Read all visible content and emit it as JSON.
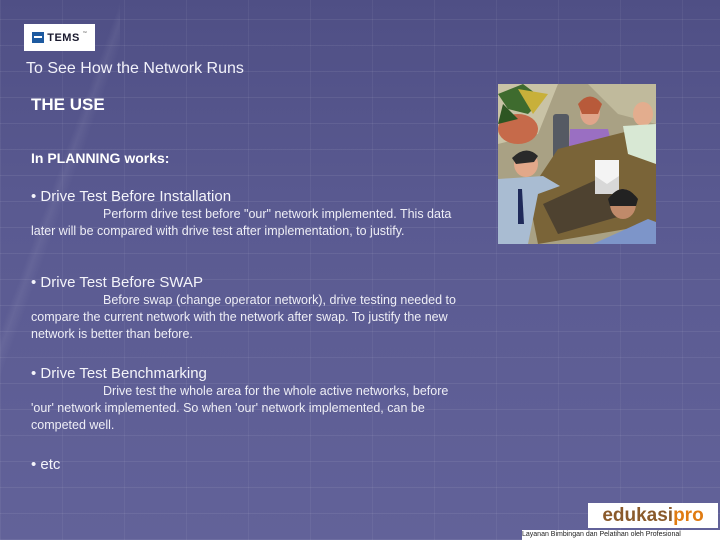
{
  "logo": {
    "brand": "TEMS",
    "trademark": "™"
  },
  "slide": {
    "title": "To See How the Network Runs",
    "section": "THE USE",
    "subsection": "In PLANNING works:",
    "items": [
      {
        "head": "• Drive Test Before Installation",
        "body": "Perform drive test before \"our\" network implemented. This data later will be compared with drive test after implementation, to justify."
      },
      {
        "head": "• Drive Test Before SWAP",
        "body": "Before swap (change operator network), drive testing needed to compare the current network with the network after swap. To justify  the new network is better  than before."
      },
      {
        "head": "• Drive Test Benchmarking",
        "body": "Drive test the whole area for the whole active networks, before 'our' network implemented. So when 'our' network implemented, can be competed well."
      },
      {
        "head": "• etc",
        "body": ""
      }
    ]
  },
  "illustration": {
    "subject": "business-meeting-clipart"
  },
  "footer_logo": {
    "part1": "edukasi",
    "part2": "pro",
    "tagline": "Layanan Bimbingan dan Pelatihan oleh Profesional"
  }
}
